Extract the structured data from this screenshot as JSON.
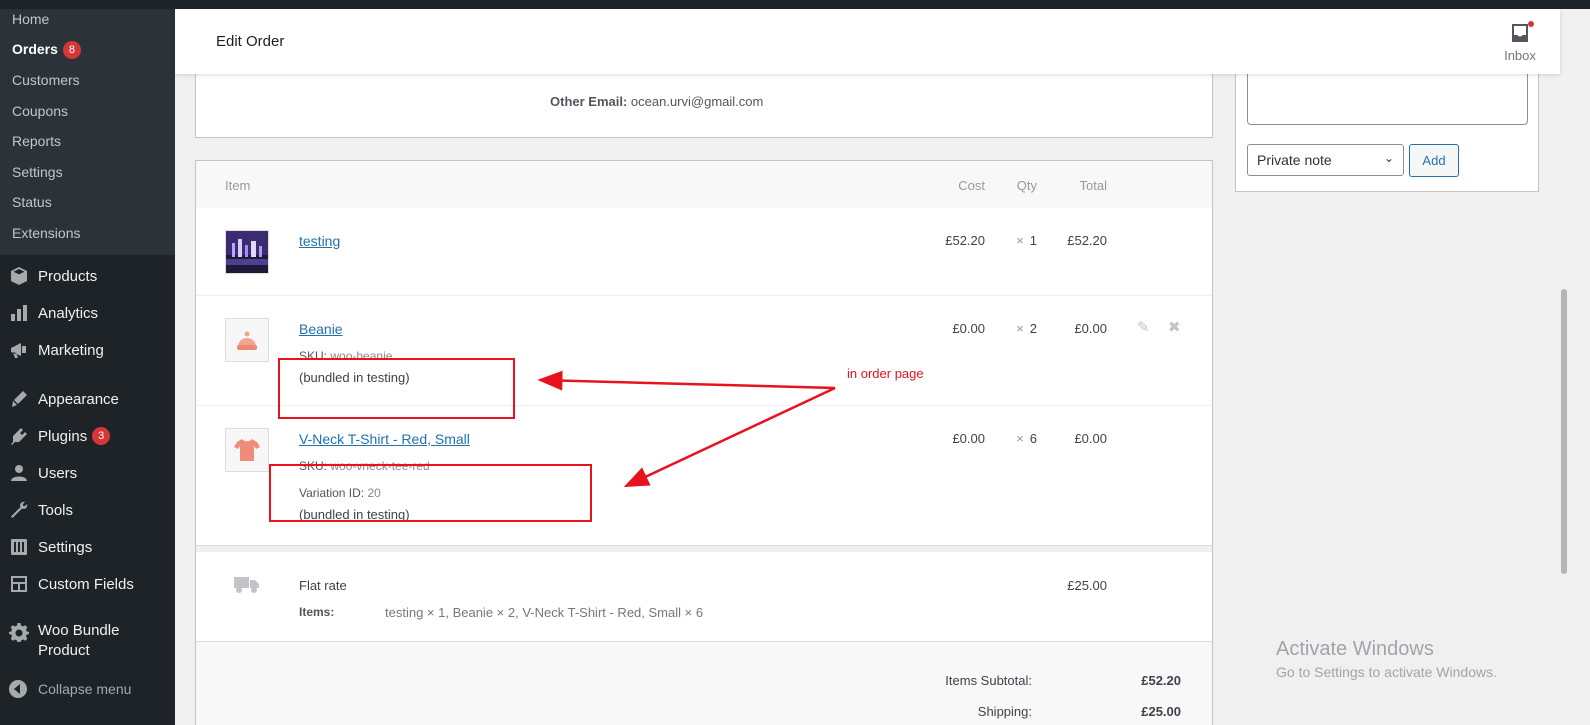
{
  "sidebar": {
    "submenu": [
      {
        "label": "Home"
      },
      {
        "label": "Orders",
        "badge": "8"
      },
      {
        "label": "Customers"
      },
      {
        "label": "Coupons"
      },
      {
        "label": "Reports"
      },
      {
        "label": "Settings"
      },
      {
        "label": "Status"
      },
      {
        "label": "Extensions"
      }
    ],
    "menu": [
      {
        "label": "Products",
        "icon": "products-icon"
      },
      {
        "label": "Analytics",
        "icon": "analytics-icon"
      },
      {
        "label": "Marketing",
        "icon": "marketing-icon"
      },
      {
        "label": "Appearance",
        "icon": "appearance-icon"
      },
      {
        "label": "Plugins",
        "icon": "plugins-icon",
        "badge": "3"
      },
      {
        "label": "Users",
        "icon": "users-icon"
      },
      {
        "label": "Tools",
        "icon": "tools-icon"
      },
      {
        "label": "Settings",
        "icon": "settings-icon"
      },
      {
        "label": "Custom Fields",
        "icon": "custom-fields-icon"
      },
      {
        "label": "Woo Bundle",
        "label2": "Product",
        "icon": "gear-icon"
      }
    ],
    "collapse_label": "Collapse menu"
  },
  "header": {
    "title": "Edit Order",
    "inbox_label": "Inbox"
  },
  "address": {
    "other_email_label": "Other Email:",
    "other_email_value": "ocean.urvi@gmail.com"
  },
  "items": {
    "columns": {
      "item": "Item",
      "cost": "Cost",
      "qty": "Qty",
      "total": "Total"
    },
    "rows": [
      {
        "name": "testing",
        "cost": "£52.20",
        "qty_x": "×",
        "qty": "1",
        "total": "£52.20"
      },
      {
        "name": "Beanie",
        "sku_label": "SKU:",
        "sku": "woo-beanie",
        "bundled": "(bundled in testing)",
        "cost": "£0.00",
        "qty_x": "×",
        "qty": "2",
        "total": "£0.00"
      },
      {
        "name": "V-Neck T-Shirt - Red, Small",
        "sku_label": "SKU:",
        "sku": "woo-vneck-tee-red",
        "variation_label": "Variation ID:",
        "variation": "20",
        "bundled": "(bundled in testing)",
        "cost": "£0.00",
        "qty_x": "×",
        "qty": "6",
        "total": "£0.00"
      }
    ],
    "shipping": {
      "name": "Flat rate",
      "items_label": "Items:",
      "items_value": "testing × 1, Beanie × 2, V-Neck T-Shirt - Red, Small × 6",
      "total": "£25.00"
    },
    "totals": [
      {
        "label": "Items Subtotal:",
        "value": "£52.20"
      },
      {
        "label": "Shipping:",
        "value": "£25.00"
      }
    ]
  },
  "notes": {
    "note_type": "Private note",
    "add_label": "Add"
  },
  "annotation": {
    "label": "in order page",
    "color": "#e8111e"
  },
  "watermark": {
    "title": "Activate Windows",
    "subtitle": "Go to Settings to activate Windows."
  }
}
